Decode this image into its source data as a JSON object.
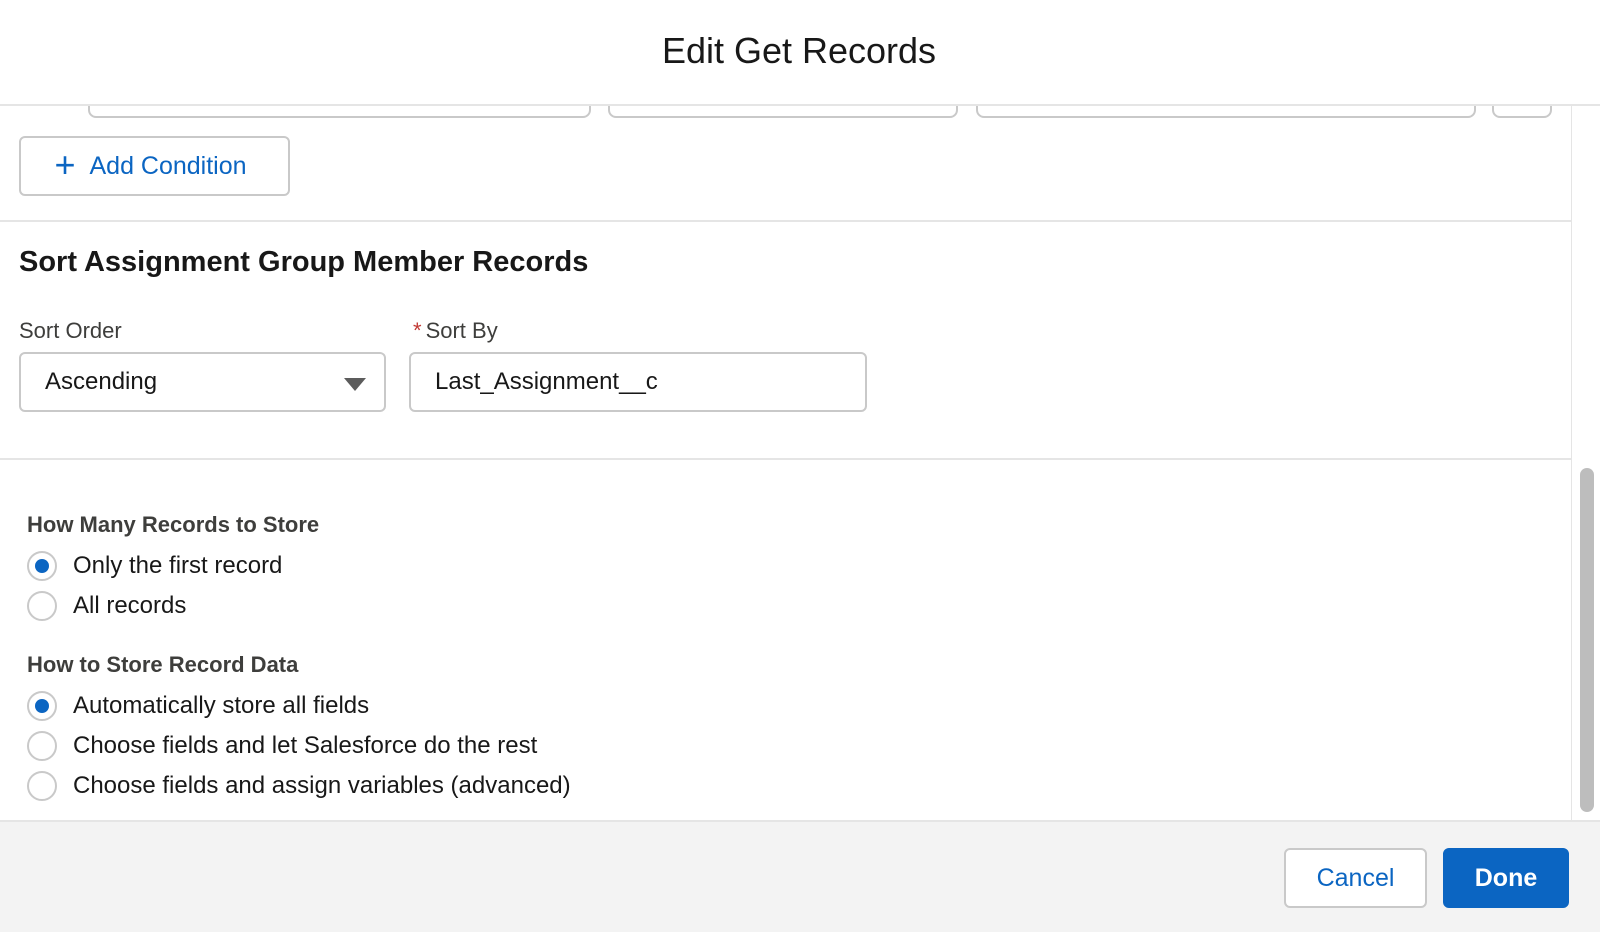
{
  "modal": {
    "title": "Edit Get Records"
  },
  "conditions": {
    "add_condition_label": "Add Condition"
  },
  "sort": {
    "section_title": "Sort Assignment Group Member Records",
    "order_label": "Sort Order",
    "order_value": "Ascending",
    "sort_by_label": "Sort By",
    "sort_by_required_mark": "*",
    "sort_by_value": "Last_Assignment__c"
  },
  "records_to_store": {
    "label": "How Many Records to Store",
    "options": [
      {
        "label": "Only the first record",
        "checked": true
      },
      {
        "label": "All records",
        "checked": false
      }
    ]
  },
  "store_data": {
    "label": "How to Store Record Data",
    "options": [
      {
        "label": "Automatically store all fields",
        "checked": true
      },
      {
        "label": "Choose fields and let Salesforce do the rest",
        "checked": false
      },
      {
        "label": "Choose fields and assign variables (advanced)",
        "checked": false
      }
    ]
  },
  "footer": {
    "cancel_label": "Cancel",
    "done_label": "Done"
  },
  "colors": {
    "brand": "#0b65c2",
    "required": "#c23934",
    "border": "#c9c9c9"
  }
}
